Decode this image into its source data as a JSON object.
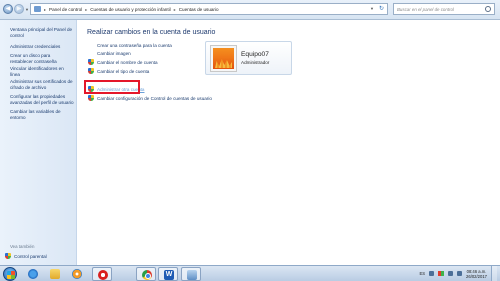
{
  "address_bar": {
    "breadcrumbs": [
      "Panel de control",
      "Cuentas de usuario y protección infantil",
      "Cuentas de usuario"
    ],
    "search_placeholder": "Buscar en el panel de control"
  },
  "left_pane": {
    "links": [
      "Ventana principal del Panel de control",
      "Administrar credenciales",
      "Crear un disco para restablecer contraseña",
      "Vincular identificadores en línea",
      "Administrar sus certificados de cifrado de archivo",
      "Configurar las propiedades avanzadas del perfil de usuario",
      "Cambiar las variables de entorno"
    ],
    "see_also_label": "Vea también",
    "parental_control": "Control parental"
  },
  "main": {
    "title": "Realizar cambios en la cuenta de usuario",
    "tasks": [
      {
        "label": "Crear una contraseña para la cuenta",
        "icon": "none"
      },
      {
        "label": "Cambiar imagen",
        "icon": "none"
      },
      {
        "label": "Cambiar el nombre de cuenta",
        "icon": "shield-icon"
      },
      {
        "label": "Cambiar el tipo de cuenta",
        "icon": "shield-icon"
      },
      {
        "label": "Administrar otra cuenta",
        "icon": "shield-icon"
      },
      {
        "label": "Cambiar configuración de Control de cuentas de usuario",
        "icon": "shield-icon"
      }
    ]
  },
  "account": {
    "name": "Equipo07",
    "role": "Administrador"
  },
  "taskbar": {
    "apps": [
      "internet-explorer",
      "windows-explorer",
      "media-player",
      "opera",
      "chrome",
      "word",
      "control-panel"
    ],
    "language": "ES",
    "time": "08:46 a.m.",
    "date": "26/02/2017"
  },
  "colors": {
    "highlight_box": "#e4172a",
    "link": "#1a3b6e",
    "title": "#1e3a6e"
  }
}
